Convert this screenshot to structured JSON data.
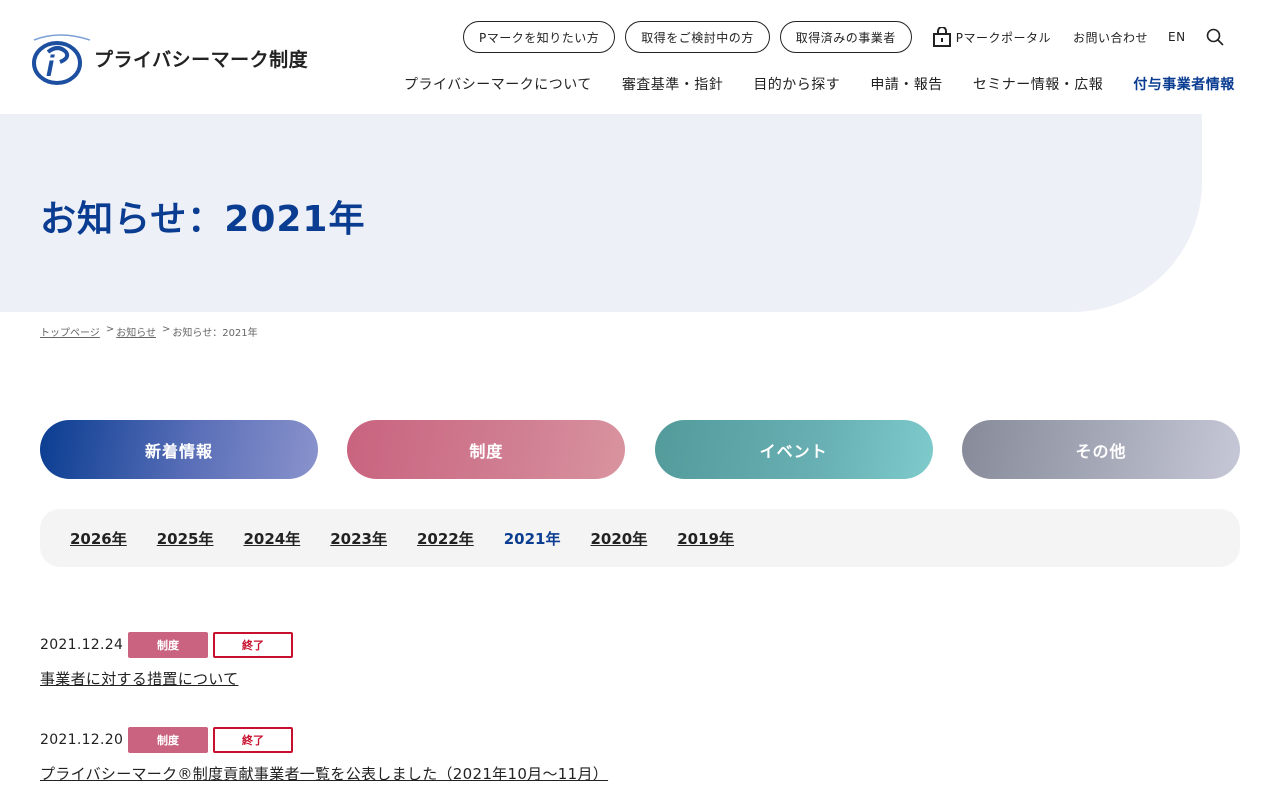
{
  "site": {
    "logo_text": "プライバシーマーク制度"
  },
  "util": {
    "pills": [
      "Pマークを知りたい方",
      "取得をご検討中の方",
      "取得済みの事業者"
    ],
    "portal": "Pマークポータル",
    "contact": "お問い合わせ",
    "lang": "EN"
  },
  "nav": {
    "items": [
      "プライバシーマークについて",
      "審査基準・指針",
      "目的から探す",
      "申請・報告",
      "セミナー情報・広報"
    ],
    "highlight": "付与事業者情報"
  },
  "hero": {
    "title": "お知らせ：2021年"
  },
  "breadcrumb": {
    "home": "トップページ",
    "news": "お知らせ",
    "current": "お知らせ：2021年",
    "separator": ">"
  },
  "categories": [
    "新着情報",
    "制度",
    "イベント",
    "その他"
  ],
  "years": {
    "tabs": [
      "2026年",
      "2025年",
      "2024年",
      "2023年",
      "2022年",
      "2021年",
      "2020年",
      "2019年"
    ],
    "active": "2021年"
  },
  "news": [
    {
      "date": "2021.12.24",
      "category": "制度",
      "status": "終了",
      "title": "事業者に対する措置について"
    },
    {
      "date": "2021.12.20",
      "category": "制度",
      "status": "終了",
      "title": "プライバシーマーク®制度貢献事業者一覧を公表しました（2021年10月～11月）"
    }
  ],
  "colors": {
    "brand_blue": "#0a3d91",
    "hero_bg": "#eef0f7",
    "system_pink": "#c9637f",
    "status_red": "#c8102e"
  },
  "icons": {
    "portal": "lock-bag-icon",
    "search": "search-icon"
  }
}
